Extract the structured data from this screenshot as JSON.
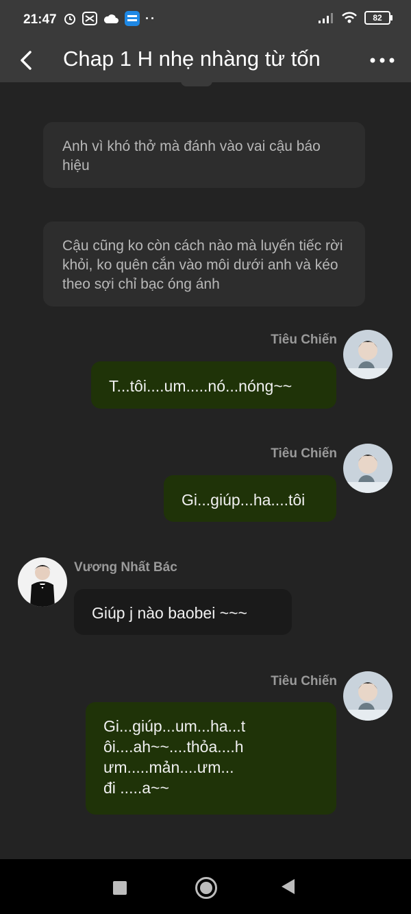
{
  "status": {
    "time": "21:47",
    "battery": "82"
  },
  "header": {
    "title": "Chap 1 H nhẹ nhàng từ tốn"
  },
  "messages": [
    {
      "kind": "narration",
      "text": "Anh vì khó thở mà đánh vào vai cậu báo hiệu"
    },
    {
      "kind": "narration",
      "text": "Cậu cũng ko còn cách nào mà luyến tiếc rời khỏi, ko quên cắn vào môi dưới anh và kéo theo sợi chỉ bạc óng ánh"
    },
    {
      "kind": "right",
      "sender": "Tiêu Chiến",
      "text": "T...tôi....um.....nó...nóng~~"
    },
    {
      "kind": "right",
      "sender": "Tiêu Chiến",
      "text": "Gi...giúp...ha....tôi"
    },
    {
      "kind": "left",
      "sender": "Vương Nhất Bác",
      "text": "Giúp j nào baobei ~~~"
    },
    {
      "kind": "right",
      "sender": "Tiêu Chiến",
      "lines": [
        "Gi...giúp...um...ha...t",
        "ôi....ah~~....thỏa....h",
        "ưm.....mản....ưm...",
        "đi .....a~~"
      ]
    }
  ],
  "colors": {
    "bubble_me": "#1f3308",
    "bubble_other": "#1a1a1a",
    "narration_bg": "#2d2d2d",
    "background": "#232323"
  }
}
